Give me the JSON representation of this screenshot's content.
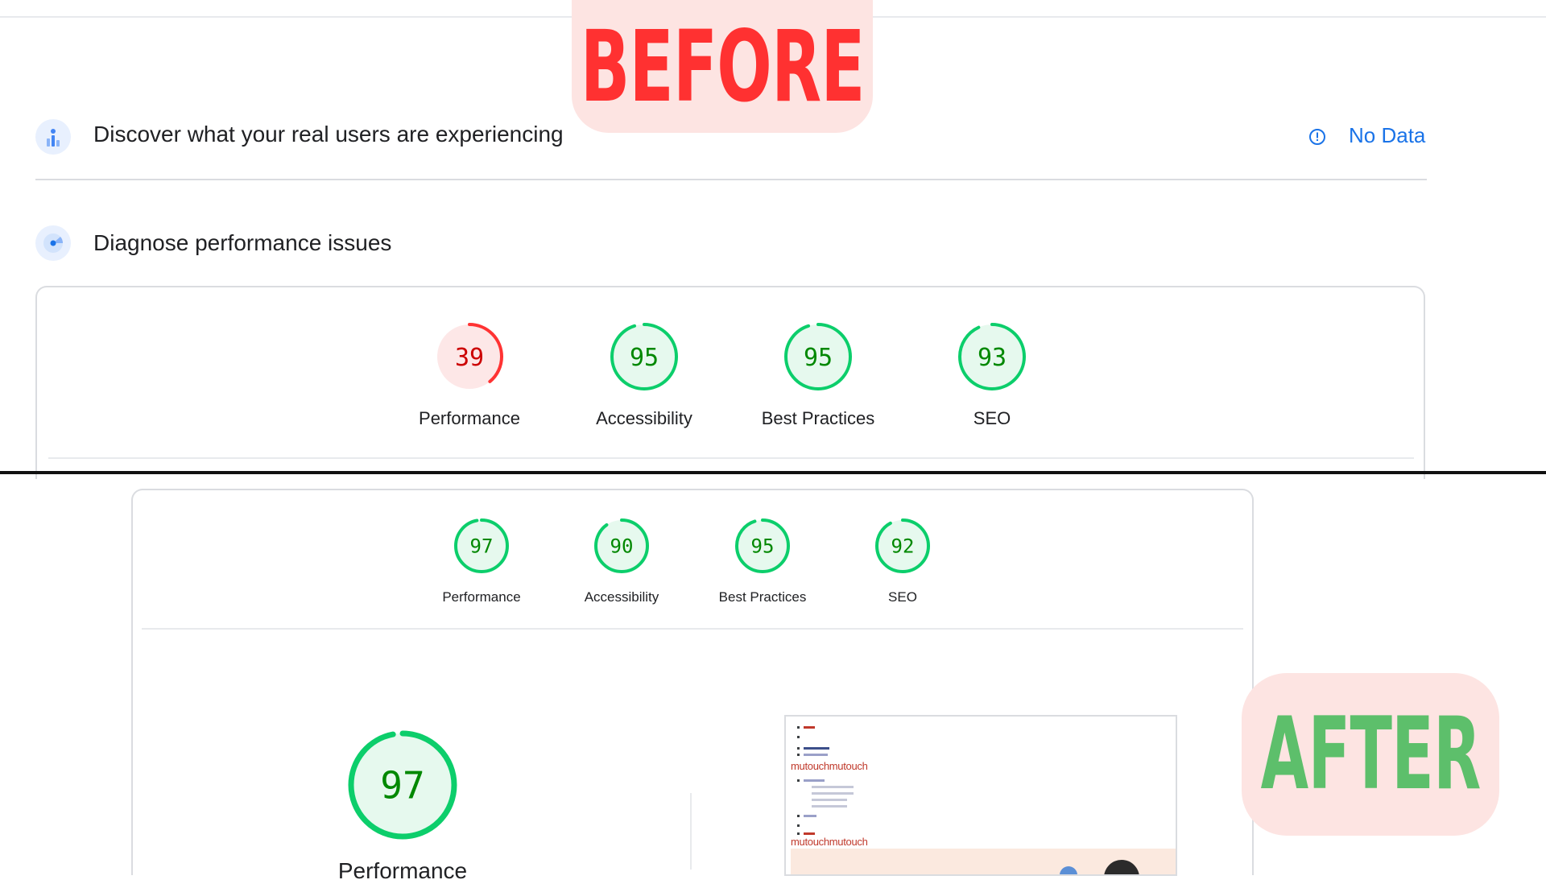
{
  "badges": {
    "before": "BEFORE",
    "after": "AFTER"
  },
  "before": {
    "field_data": {
      "title": "Discover what your real users are experiencing",
      "status_label": "No Data",
      "icon": "users-chart-icon",
      "status_icon": "info-icon"
    },
    "lab_data": {
      "title": "Diagnose performance issues",
      "icon": "diagnose-icon"
    },
    "scores": [
      {
        "label": "Performance",
        "score": 39,
        "rating": "fail"
      },
      {
        "label": "Accessibility",
        "score": 95,
        "rating": "pass"
      },
      {
        "label": "Best Practices",
        "score": 95,
        "rating": "pass"
      },
      {
        "label": "SEO",
        "score": 93,
        "rating": "pass"
      }
    ]
  },
  "after": {
    "scores": [
      {
        "label": "Performance",
        "score": 97,
        "rating": "pass"
      },
      {
        "label": "Accessibility",
        "score": 90,
        "rating": "pass"
      },
      {
        "label": "Best Practices",
        "score": 95,
        "rating": "pass"
      },
      {
        "label": "SEO",
        "score": 92,
        "rating": "pass"
      }
    ],
    "main_gauge": {
      "label": "Performance",
      "score": 97,
      "rating": "pass"
    },
    "screenshot": {
      "logo_text": "mutouchmutouch",
      "icon": "page-screenshot-thumbnail"
    }
  },
  "colors": {
    "pass": "#0cce6b",
    "pass_text": "#008800",
    "pass_bg": "#e6f9ee",
    "fail": "#ff3333",
    "fail_text": "#cc0000",
    "fail_bg": "#fde7e7",
    "link": "#1a73e8",
    "before_badge": "#ff3131",
    "after_badge": "#5dbf6b",
    "badge_bg": "#fde4e2"
  }
}
